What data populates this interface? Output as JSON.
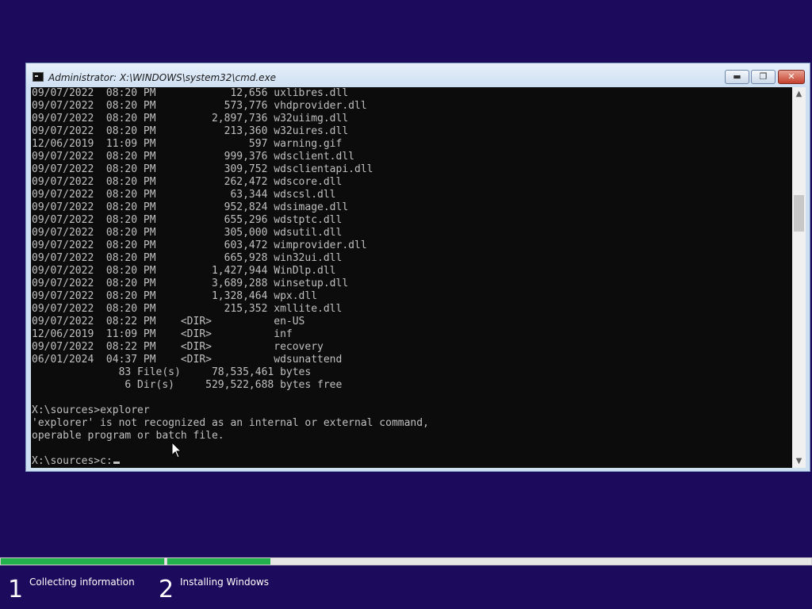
{
  "window": {
    "title": "Administrator: X:\\WINDOWS\\system32\\cmd.exe",
    "buttons": {
      "minimize": "▬",
      "maximize": "❐",
      "close": "✕"
    }
  },
  "console": {
    "lines": [
      "09/07/2022  08:20 PM            12,656 uxlibres.dll",
      "09/07/2022  08:20 PM           573,776 vhdprovider.dll",
      "09/07/2022  08:20 PM         2,897,736 w32uiimg.dll",
      "09/07/2022  08:20 PM           213,360 w32uires.dll",
      "12/06/2019  11:09 PM               597 warning.gif",
      "09/07/2022  08:20 PM           999,376 wdsclient.dll",
      "09/07/2022  08:20 PM           309,752 wdsclientapi.dll",
      "09/07/2022  08:20 PM           262,472 wdscore.dll",
      "09/07/2022  08:20 PM            63,344 wdscsl.dll",
      "09/07/2022  08:20 PM           952,824 wdsimage.dll",
      "09/07/2022  08:20 PM           655,296 wdstptc.dll",
      "09/07/2022  08:20 PM           305,000 wdsutil.dll",
      "09/07/2022  08:20 PM           603,472 wimprovider.dll",
      "09/07/2022  08:20 PM           665,928 win32ui.dll",
      "09/07/2022  08:20 PM         1,427,944 WinDlp.dll",
      "09/07/2022  08:20 PM         3,689,288 winsetup.dll",
      "09/07/2022  08:20 PM         1,328,464 wpx.dll",
      "09/07/2022  08:20 PM           215,352 xmllite.dll",
      "09/07/2022  08:22 PM    <DIR>          en-US",
      "12/06/2019  11:09 PM    <DIR>          inf",
      "09/07/2022  08:22 PM    <DIR>          recovery",
      "06/01/2024  04:37 PM    <DIR>          wdsunattend",
      "              83 File(s)     78,535,461 bytes",
      "               6 Dir(s)     529,522,688 bytes free",
      "",
      "X:\\sources>explorer",
      "'explorer' is not recognized as an internal or external command,",
      "operable program or batch file.",
      ""
    ],
    "prompt": "X:\\sources>c:"
  },
  "scrollbar": {
    "up_arrow": "▲",
    "down_arrow": "▼"
  },
  "progress": {
    "steps": [
      {
        "number": "1",
        "label": "Collecting information",
        "fill": 1.0
      },
      {
        "number": "2",
        "label": "Installing Windows",
        "fill": 0.16
      }
    ],
    "fill_color": "#22b14c"
  },
  "colors": {
    "desktop": "#1c0a5c",
    "console_bg": "#0c0c0c",
    "console_fg": "#c0c0c0"
  }
}
